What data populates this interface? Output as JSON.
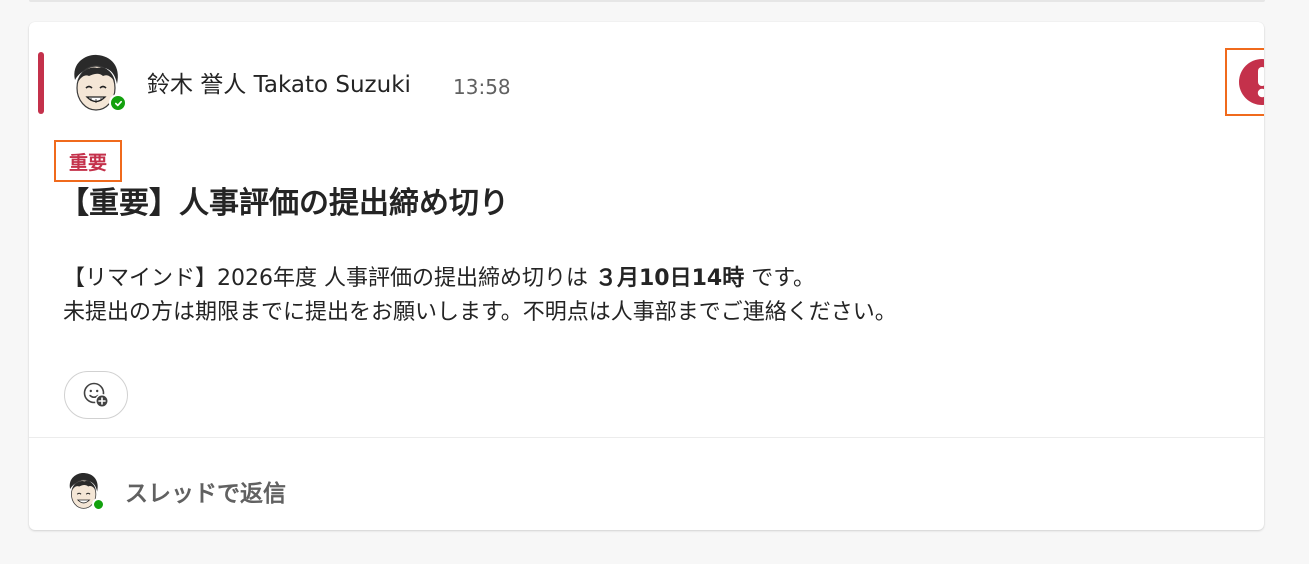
{
  "message": {
    "sender": "鈴木 誉人 Takato Suzuki",
    "time": "13:58",
    "importance_tag": "重要",
    "subject": "【重要】人事評価の提出締め切り",
    "body_line1_prefix": "【リマインド】2026年度 人事評価の提出締め切りは ",
    "body_line1_bold": "３月10日14時",
    "body_line1_suffix": " です。",
    "body_line2": "未提出の方は期限までに提出をお願いします。不明点は人事部までご連絡ください。",
    "presence_status": "available"
  },
  "reply": {
    "label": "スレッドで返信"
  },
  "colors": {
    "important_red": "#c4314b",
    "highlight_orange": "#f06a1c",
    "presence_green": "#13a10e"
  },
  "icons": {
    "important": "exclamation-circle-icon",
    "reaction": "add-emoji-icon",
    "presence": "presence-available-icon"
  }
}
